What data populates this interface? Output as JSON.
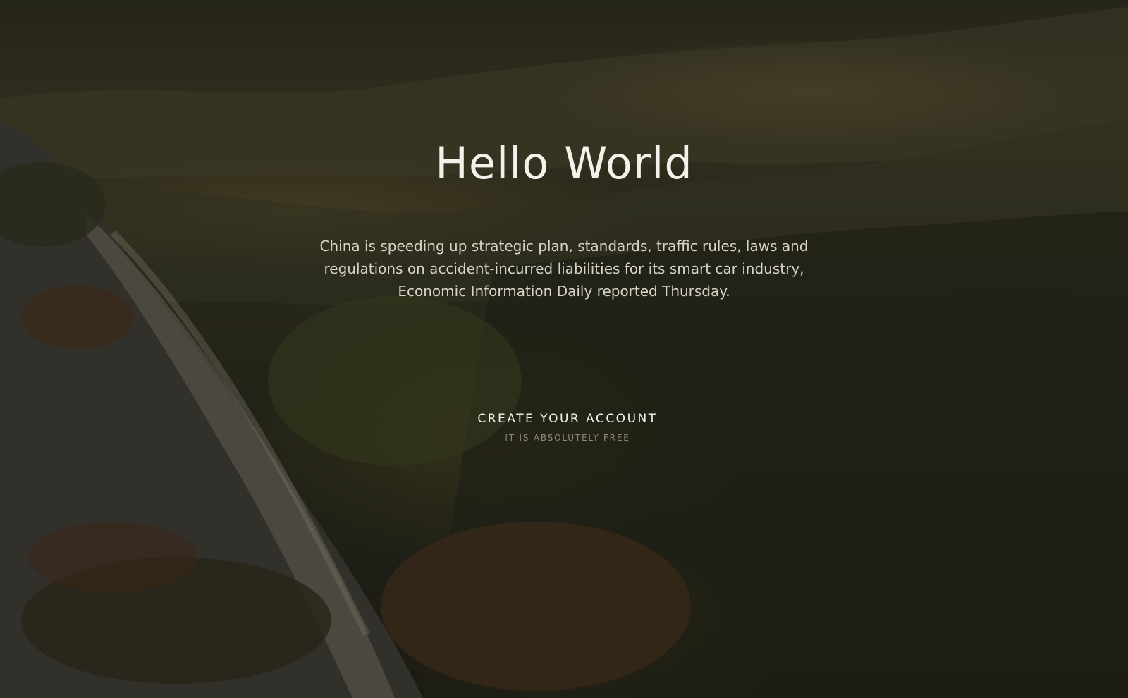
{
  "hero": {
    "title": "Hello World",
    "description": "China is speeding up strategic plan, standards, traffic rules, laws and regulations on accident-incurred liabilities for its smart car industry, Economic Information Daily reported Thursday.",
    "cta_label": "CREATE YOUR ACCOUNT",
    "cta_sublabel": "IT IS ABSOLUTELY FREE",
    "background_image": "misty forested mountains with granite cliff at sunrise"
  }
}
